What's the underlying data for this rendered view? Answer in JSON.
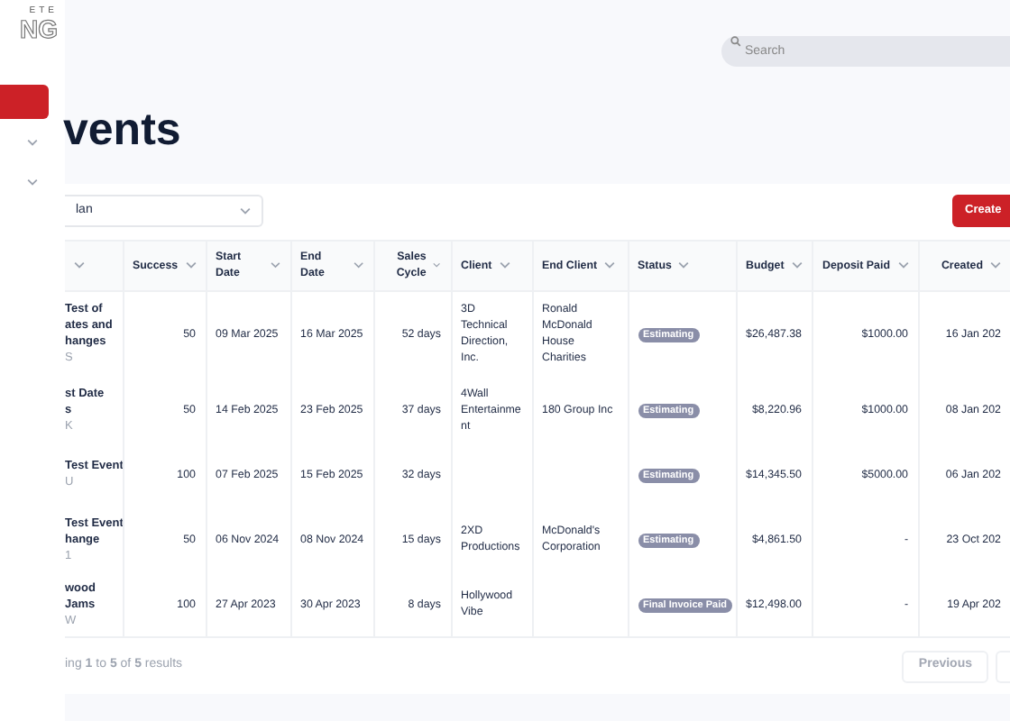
{
  "logo": {
    "lines": [
      "ETE",
      "NG"
    ]
  },
  "sidebar": {
    "items": [
      {
        "selected": true,
        "has_children": false
      },
      {
        "selected": false,
        "has_children": true
      },
      {
        "selected": false,
        "has_children": true
      }
    ]
  },
  "search": {
    "placeholder": "Search"
  },
  "page_title": "vents",
  "filter": {
    "value": "lan"
  },
  "create_button": "Create",
  "table": {
    "columns": [
      {},
      {
        "label": "Success"
      },
      {
        "label": "Start Date"
      },
      {
        "label": "End Date"
      },
      {
        "label": "Sales Cycle"
      },
      {
        "label": "Client"
      },
      {
        "label": "End Client"
      },
      {
        "label": "Status"
      },
      {
        "label": "Budget"
      },
      {
        "label": "Deposit Paid"
      },
      {
        "label": "Created"
      }
    ],
    "rows": [
      {
        "name": [
          "Test of",
          "ates and",
          "hanges"
        ],
        "code": "S",
        "success": "50",
        "start": "09 Mar 2025",
        "end": "16 Mar 2025",
        "cycle": "52 days",
        "client": "3D Technical Direction, Inc.",
        "end_client": "Ronald McDonald House Charities",
        "status": "Estimating",
        "budget": "$26,487.38",
        "deposit": "$1000.00",
        "created": "16 Jan 202"
      },
      {
        "name": [
          "st Date",
          "s"
        ],
        "code": "K",
        "success": "50",
        "start": "14 Feb 2025",
        "end": "23 Feb 2025",
        "cycle": "37 days",
        "client": "4Wall Entertainme nt",
        "end_client": "180 Group Inc",
        "status": "Estimating",
        "budget": "$8,220.96",
        "deposit": "$1000.00",
        "created": "08 Jan 202"
      },
      {
        "name": [
          "Test Event"
        ],
        "code": "U",
        "success": "100",
        "start": "07 Feb 2025",
        "end": "15 Feb 2025",
        "cycle": "32 days",
        "status": "Estimating",
        "budget": "$14,345.50",
        "deposit": "$5000.00",
        "created": "06 Jan 202"
      },
      {
        "name": [
          "Test Event",
          "hange"
        ],
        "code": "1",
        "success": "50",
        "start": "06 Nov 2024",
        "end": "08 Nov 2024",
        "cycle": "15 days",
        "client": "2XD Productions",
        "end_client": "McDonald's Corporation",
        "status": "Estimating",
        "budget": "$4,861.50",
        "deposit": "-",
        "created": "23 Oct 202"
      },
      {
        "name": [
          "wood",
          "Jams"
        ],
        "code": "W",
        "success": "100",
        "start": "27 Apr 2023",
        "end": "30 Apr 2023",
        "cycle": "8 days",
        "client": "Hollywood Vibe",
        "status": "Final Invoice Paid",
        "budget": "$12,498.00",
        "deposit": "-",
        "created": "19 Apr 202"
      }
    ]
  },
  "footer": {
    "summary": "ing **1** to **5** of **5** results",
    "previous": {
      "label": "Previous",
      "disabled": true
    }
  }
}
